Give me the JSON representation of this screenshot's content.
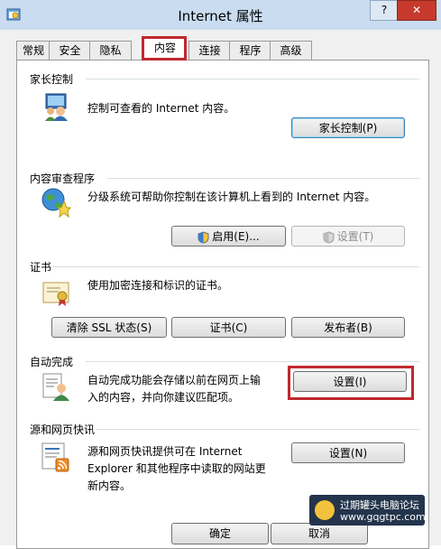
{
  "window": {
    "title": "Internet 属性",
    "help_label": "?",
    "close_label": "✕"
  },
  "tabs": [
    {
      "label": "常规"
    },
    {
      "label": "安全"
    },
    {
      "label": "隐私"
    },
    {
      "label": "内容",
      "active": true
    },
    {
      "label": "连接"
    },
    {
      "label": "程序"
    },
    {
      "label": "高级"
    }
  ],
  "parental": {
    "title": "家长控制",
    "description": "控制可查看的 Internet 内容。",
    "button": "家长控制(P)"
  },
  "advisor": {
    "title": "内容审查程序",
    "description": "分级系统可帮助你控制在该计算机上看到的 Internet 内容。",
    "enable_button": "启用(E)...",
    "settings_button": "设置(T)"
  },
  "certificates": {
    "title": "证书",
    "description": "使用加密连接和标识的证书。",
    "clear_ssl_button": "清除 SSL 状态(S)",
    "certificates_button": "证书(C)",
    "publishers_button": "发布者(B)"
  },
  "autocomplete": {
    "title": "自动完成",
    "description_line1": "自动完成功能会存储以前在网页上输",
    "description_line2": "入的内容，并向你建议匹配项。",
    "settings_button": "设置(I)"
  },
  "feeds": {
    "title": "源和网页快讯",
    "description_line1": "源和网页快讯提供可在 Internet",
    "description_line2": "Explorer 和其他程序中读取的网站更",
    "description_line3": "新内容。",
    "settings_button": "设置(N)"
  },
  "footer": {
    "ok_button": "确定",
    "cancel_button": "取消"
  },
  "watermark": {
    "line1": "过期罐头电脑论坛",
    "line2": "www.gqgtpc.com"
  }
}
